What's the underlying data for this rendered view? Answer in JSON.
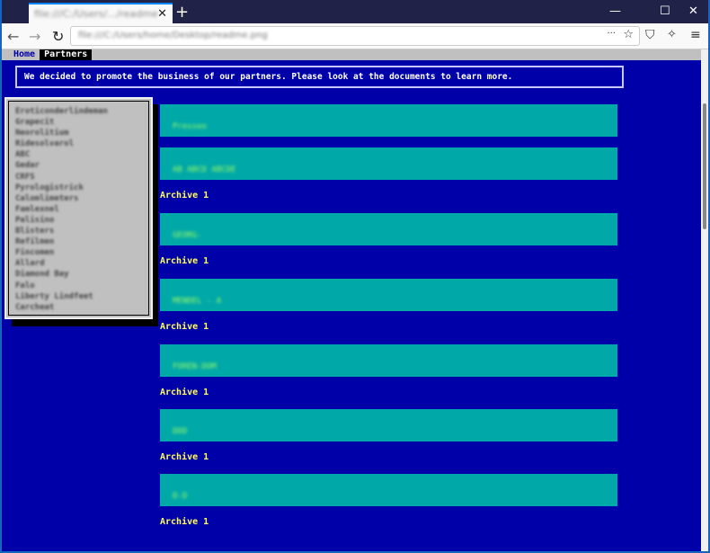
{
  "browser": {
    "tab_title": "file:///C:/Users/.../readme.png",
    "url": "file:///C:/Users/home/Desktop/readme.png"
  },
  "menu": {
    "home": "Home",
    "partners": "Partners"
  },
  "notice": "We decided to promote the business of our partners. Please look at the documents to learn more.",
  "partners": [
    "Eroticonderlindeman",
    "Grapecit",
    "Neorolitium",
    "Ridesolvarol",
    "ABC",
    "Gedar",
    "CRFS",
    "Pyrologistrick",
    "Calomlimeters",
    "Famlexnel",
    "Palisino",
    "Blisters",
    "Refilmen",
    "Fincomen",
    "Allard",
    "Diamond Bay",
    "Falo",
    "Liberty Lindfeet",
    "Carcheat"
  ],
  "documents": [
    {
      "name": "Presseo",
      "archive": ""
    },
    {
      "name": "AB  ABCD  ABCDE",
      "archive": "Archive 1"
    },
    {
      "name": "GEORG-",
      "archive": "Archive 1"
    },
    {
      "name": "MENDEL - A",
      "archive": "Archive 1"
    },
    {
      "name": "FOREN-DOM",
      "archive": "Archive 1"
    },
    {
      "name": "DDD",
      "archive": "Archive 1"
    },
    {
      "name": "D-D",
      "archive": "Archive 1"
    }
  ],
  "colors": {
    "page_bg": "#0000a8",
    "bar": "#00a8a8",
    "archive": "#ffff55"
  }
}
